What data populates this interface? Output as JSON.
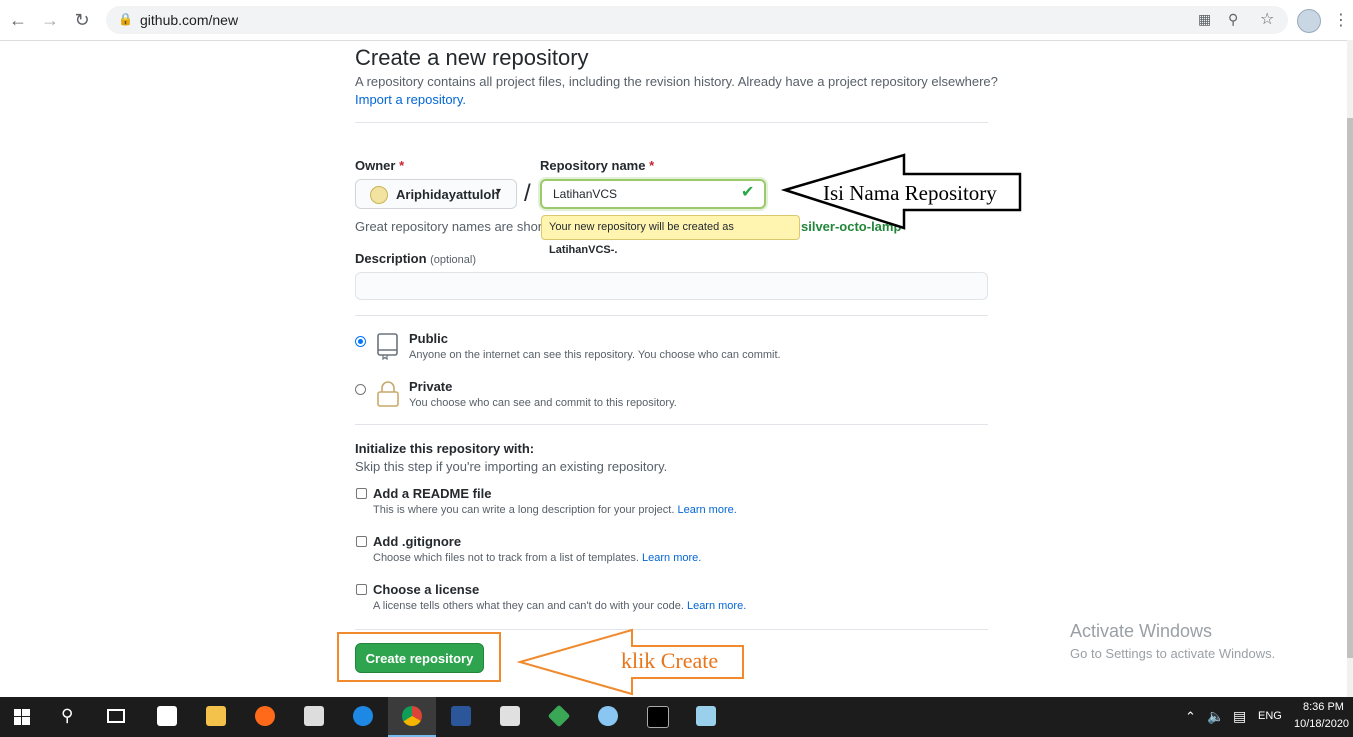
{
  "browser": {
    "url": "github.com/new",
    "icons": [
      "back-arrow-icon",
      "forward-arrow-icon",
      "reload-icon",
      "lock-icon",
      "translate-icon",
      "zoom-icon",
      "star-icon",
      "profile-icon",
      "kebab-menu-icon"
    ]
  },
  "page": {
    "title": "Create a new repository",
    "subtitle": "A repository contains all project files, including the revision history. Already have a project repository elsewhere?",
    "import_link": "Import a repository.",
    "owner_label": "Owner",
    "required_mark": "*",
    "owner_name": "Ariphidayattuloh",
    "slash": "/",
    "repo_label": "Repository name",
    "repo_value": "LatihanVCS",
    "tooltip_prefix": "Your new repository will be created as ",
    "tooltip_name": "LatihanVCS-.",
    "great_names": "Great repository names are short",
    "suggestion": "silver-octo-lamp",
    "description_label": "Description",
    "optional": "(optional)",
    "visibility": {
      "public_title": "Public",
      "public_desc": "Anyone on the internet can see this repository. You choose who can commit.",
      "private_title": "Private",
      "private_desc": "You choose who can see and commit to this repository.",
      "selected": "Public"
    },
    "init": {
      "heading": "Initialize this repository with:",
      "subheading": "Skip this step if you're importing an existing repository.",
      "readme_title": "Add a README file",
      "readme_desc": "This is where you can write a long description for your project.",
      "gitignore_title": "Add .gitignore",
      "gitignore_desc": "Choose which files not to track from a list of templates.",
      "license_title": "Choose a license",
      "license_desc": "A license tells others what they can and can't do with your code.",
      "learn_more": "Learn more."
    },
    "create_button": "Create repository"
  },
  "annotations": {
    "name_note": "Isi Nama Repository",
    "create_note": "klik Create"
  },
  "watermark": {
    "title": "Activate Windows",
    "subtitle": "Go to Settings to activate Windows."
  },
  "taskbar": {
    "time": "8:36 PM",
    "date": "10/18/2020",
    "lang": "ENG",
    "apps": [
      "start",
      "search",
      "task-view",
      "store",
      "file-explorer",
      "firefox",
      "camera",
      "edge",
      "chrome",
      "word",
      "photos",
      "git",
      "paint",
      "terminal",
      "notepad"
    ]
  },
  "colors": {
    "primary_button": "#2ea44f",
    "link": "#0366d6",
    "tooltip_bg": "#fff5b1",
    "annotation_orange": "#f08a2c",
    "suggestion_green": "#22863a"
  }
}
